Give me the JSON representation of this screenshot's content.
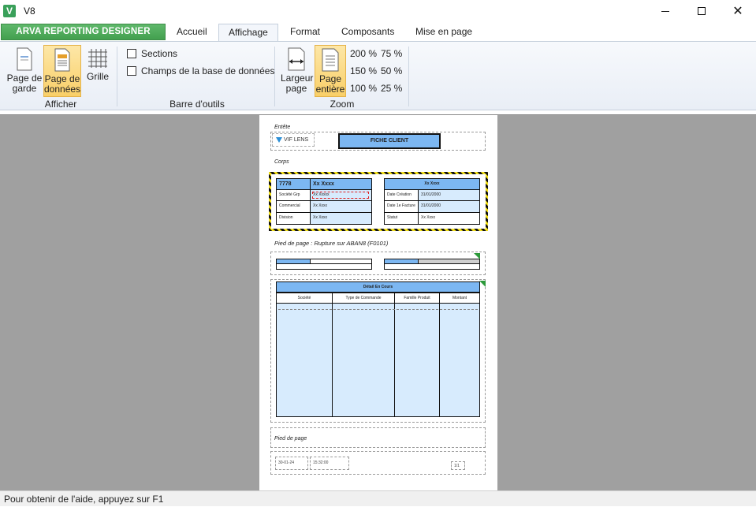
{
  "window": {
    "title": "V8",
    "app_icon": "V"
  },
  "tabs": {
    "app_tab": "ARVA REPORTING DESIGNER",
    "items": [
      "Accueil",
      "Affichage",
      "Format",
      "Composants",
      "Mise en page"
    ],
    "active": "Affichage"
  },
  "ribbon": {
    "afficher": {
      "label": "Afficher",
      "page_garde": [
        "Page de",
        "garde"
      ],
      "page_donnees": [
        "Page de",
        "données"
      ],
      "grille": "Grille"
    },
    "barre_outils": {
      "label": "Barre d'outils",
      "sections": "Sections",
      "champs": "Champs de la base de données"
    },
    "zoom": {
      "label": "Zoom",
      "largeur_page": [
        "Largeur",
        "page"
      ],
      "page_entiere": [
        "Page",
        "entière"
      ],
      "options": [
        "200 %",
        "75 %",
        "150 %",
        "50 %",
        "100 %",
        "25 %"
      ]
    }
  },
  "report": {
    "entete": "Entête",
    "logo_text": "VIF LENS",
    "fiche_client": "FICHE CLIENT",
    "corps": "Corps",
    "left_block": {
      "code": "7778",
      "name": "Xx Xxxx",
      "rows": [
        {
          "label": "Société Grp",
          "value": "Xx Xxxxx"
        },
        {
          "label": "Commercial",
          "value": "Xx Xxxx"
        },
        {
          "label": "Division",
          "value": "Xx Xxxx"
        }
      ]
    },
    "right_block": {
      "title": "Xx Xxxx",
      "rows": [
        {
          "label": "Date Création",
          "value": "31/01/2000"
        },
        {
          "label": "Date 1e Facture",
          "value": "31/01/2000"
        },
        {
          "label": "Statut",
          "value": "Xx Xxxx"
        }
      ]
    },
    "pied_rupture": "Pied de page : Rupture sur ABAN8 (F0101)",
    "detail_title": "Détail En Cours",
    "detail_columns": [
      "Société",
      "Type de Commande",
      "Famille Produit",
      "Montant"
    ],
    "pied_page": "Pied de page",
    "footer_date": "30-01-24",
    "footer_time": "15:32:00",
    "footer_page": "1/1"
  },
  "status": {
    "text": "Pour obtenir de l'aide, appuyez sur F1"
  },
  "colors": {
    "accent_green": "#43a04f",
    "selected": "#f9cf68",
    "field_blue": "#7cb7f2",
    "light_blue": "#d7ebfd"
  }
}
